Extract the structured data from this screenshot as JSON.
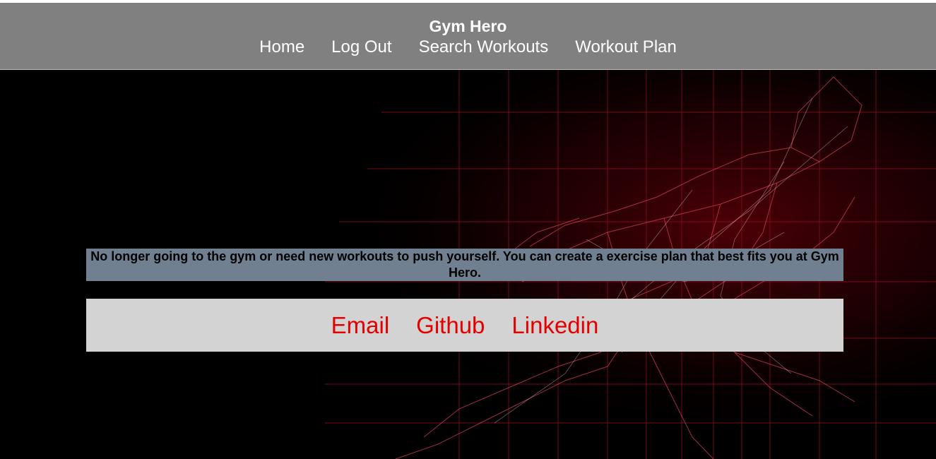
{
  "header": {
    "title": "Gym Hero",
    "nav": [
      {
        "label": "Home"
      },
      {
        "label": "Log Out"
      },
      {
        "label": "Search Workouts"
      },
      {
        "label": "Workout Plan"
      }
    ]
  },
  "hero": {
    "background_image": "red wireframe runner figure on black",
    "intro_text": "No longer going to the gym or need new workouts to push yourself. You can create a exercise plan that best fits you at Gym Hero."
  },
  "contact_links": [
    {
      "label": "Email"
    },
    {
      "label": "Github"
    },
    {
      "label": "Linkedin"
    }
  ],
  "colors": {
    "header_bg": "#808080",
    "intro_bg": "#708090",
    "contact_bg": "#d3d3d3",
    "link_red": "#e50000"
  }
}
